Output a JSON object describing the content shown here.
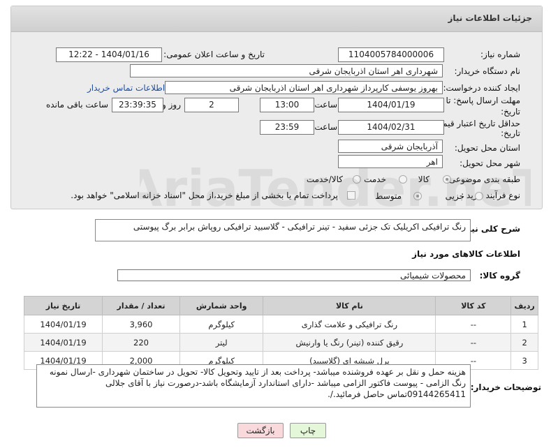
{
  "panel": {
    "title": "جزئیات اطلاعات نیاز"
  },
  "fields": {
    "need_number_label": "شماره نیاز:",
    "need_number": "1104005784000006",
    "announce_label": "تاریخ و ساعت اعلان عمومی:",
    "announce_value": "1404/01/16 - 12:22",
    "buyer_label": "نام دستگاه خریدار:",
    "buyer_value": "شهرداری اهر استان اذربایجان شرقی",
    "creator_label": "ایجاد کننده درخواست:",
    "creator_value": "بهروز یوسفی کارپرداز شهرداری اهر استان اذربایجان شرقی",
    "contact_link": "اطلاعات تماس خریدار",
    "deadline_label_1": "مهلت ارسال پاسخ: تا",
    "deadline_label_2": "تاریخ:",
    "deadline_date": "1404/01/19",
    "time_label": "ساعت",
    "deadline_time": "13:00",
    "days_value": "2",
    "days_label": "روز و",
    "remaining_time": "23:39:35",
    "remaining_label": "ساعت باقی مانده",
    "validity_label_1": "حداقل تاریخ اعتبار قیمت: تا",
    "validity_label_2": "تاریخ:",
    "validity_date": "1404/02/31",
    "validity_time_label": "ساعت",
    "validity_time": "23:59",
    "province_label": "استان محل تحویل:",
    "province_value": "آذربایجان شرقی",
    "city_label": "شهر محل تحویل:",
    "city_value": "اهر",
    "category_label": "طبقه بندی موضوعی:",
    "category_options": [
      "کالا",
      "خدمت",
      "کالا/خدمت"
    ],
    "process_label": "نوع فرآیند خرید :",
    "process_options": [
      "جزیی",
      "متوسط"
    ],
    "payment_note": "پرداخت تمام یا بخشی از مبلغ خرید،از محل \"اسناد خزانه اسلامی\" خواهد بود."
  },
  "description": {
    "label": "شرح کلی نیاز:",
    "value": "رنگ ترافیکی اکریلیک تک جزئی سفید - تینر ترافیکی - گلاسبید ترافیکی روپاش برابر برگ پیوستی"
  },
  "goods": {
    "section_title": "اطلاعات کالاهای مورد نیاز",
    "group_label": "گروه کالا:",
    "group_value": "محصولات شیمیائی"
  },
  "table": {
    "headers": [
      "ردیف",
      "کد کالا",
      "نام کالا",
      "واحد شمارش",
      "تعداد / مقدار",
      "تاریخ نیاز"
    ],
    "rows": [
      [
        "1",
        "--",
        "رنگ ترافیکی و علامت گذاری",
        "کیلوگرم",
        "3,960",
        "1404/01/19"
      ],
      [
        "2",
        "--",
        "رقیق کننده (تینر) رنگ یا وارنیش",
        "لیتر",
        "220",
        "1404/01/19"
      ],
      [
        "3",
        "--",
        "پرل شیشه ای (گلاسبید)",
        "کیلوگرم",
        "2,000",
        "1404/01/19"
      ]
    ]
  },
  "buyer_notes": {
    "label": "توضیحات خریدار:",
    "value": "هزینه حمل و نقل بر عهده فروشنده میباشد- پرداخت بعد از تایید وتحویل کالا- تحویل در ساختمان شهرداری -ارسال نمونه رنگ الزامی - پیوست فاکتور الزامی میباشد -دارای استاندارد آزمایشگاه باشد-درصورت نیاز با آقای جلالی 09144265411تماس حاصل فرمائید./."
  },
  "buttons": {
    "print": "چاپ",
    "back": "بازگشت"
  },
  "watermark": "AriaTender.neT"
}
